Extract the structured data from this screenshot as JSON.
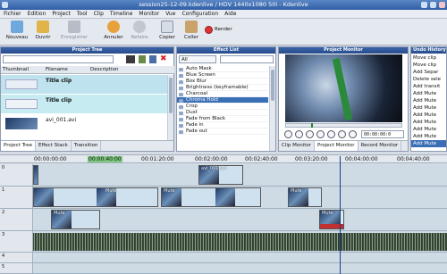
{
  "window": {
    "title": "session25-12-09.kdenlive / HDV 1440x1080 50i - Kdenlive"
  },
  "menu": [
    "Fichier",
    "Edition",
    "Project",
    "Tool",
    "Clip",
    "Timeline",
    "Monitor",
    "Vue",
    "Configuration",
    "Aide"
  ],
  "toolbar": {
    "new": "Nouveau",
    "open": "Ouvrir",
    "save": "Enregistrer",
    "undo": "Annuler",
    "redo": "Refaire",
    "copy": "Copier",
    "paste": "Coller",
    "render": "Render"
  },
  "project_tree": {
    "title": "Project Tree",
    "columns": [
      "Thumbnail",
      "Filename",
      "Description"
    ],
    "items": [
      {
        "name": "Title clip"
      },
      {
        "name": "Title clip"
      },
      {
        "name": "avi_001.avi"
      }
    ]
  },
  "effect_list": {
    "title": "Effect List",
    "filter": "All",
    "items": [
      "Auto Mask",
      "Blue Screen",
      "Box Blur",
      "Brightness (keyframable)",
      "Charcoal",
      "Chroma Hold",
      "Crop",
      "Dust",
      "Fade from Black",
      "Fade in",
      "Fade out"
    ],
    "selected": "Chroma Hold"
  },
  "project_monitor": {
    "title": "Project Monitor",
    "timecode": "00:00:00:0"
  },
  "undo_history": {
    "title": "Undo History",
    "items": [
      "Move clip",
      "Move clip",
      "Add Separ",
      "Delete sele",
      "Add transit",
      "Add Mute",
      "Add Mute",
      "Add Mute",
      "Add Mute",
      "Add Mute",
      "Add Mute",
      "Add Mute",
      "Add Mute"
    ]
  },
  "bottom_tabs": {
    "left": [
      "Project Tree",
      "Effect Stack",
      "Transition"
    ],
    "monitor": [
      "Clip Monitor",
      "Project Monitor",
      "Record Monitor"
    ]
  },
  "ruler": [
    "00:00:00:00",
    "00:00:40:00",
    "00:01:20:00",
    "00:02:00:00",
    "00:02:40:00",
    "00:03:20:00",
    "00:04:00:00",
    "00:04:40:00"
  ],
  "tracks": [
    "0",
    "1",
    "2",
    "3",
    "4",
    "5"
  ],
  "clip_labels": {
    "mute": "Mute",
    "avi": "avi_001.avi"
  }
}
